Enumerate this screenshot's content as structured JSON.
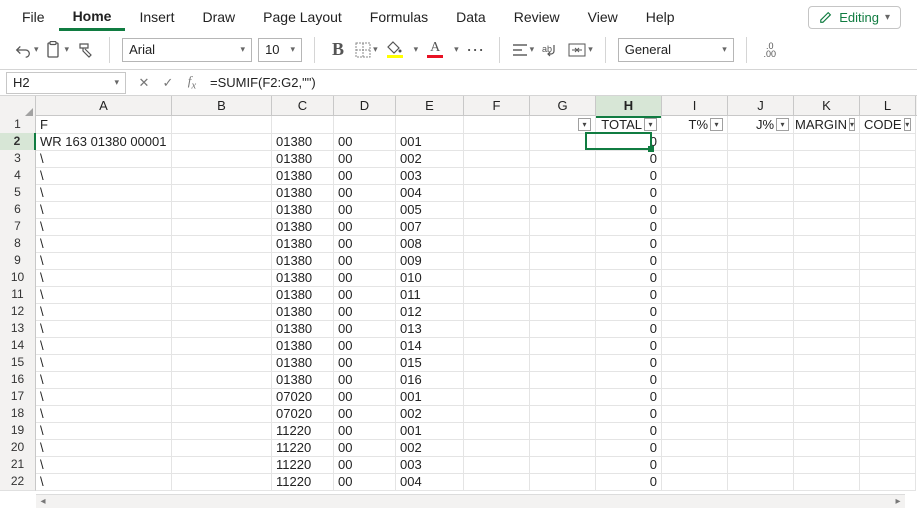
{
  "menu": {
    "tabs": [
      "File",
      "Home",
      "Insert",
      "Draw",
      "Page Layout",
      "Formulas",
      "Data",
      "Review",
      "View",
      "Help"
    ],
    "active": 1,
    "editing_label": "Editing"
  },
  "ribbon": {
    "font_name": "Arial",
    "font_size": "10",
    "number_format": "General"
  },
  "formula_bar": {
    "name_box": "H2",
    "formula": "=SUMIF(F2:G2,\"\")"
  },
  "columns": [
    "A",
    "B",
    "C",
    "D",
    "E",
    "F",
    "G",
    "H",
    "I",
    "J",
    "K",
    "L"
  ],
  "selected_column_index": 7,
  "selected_row": 2,
  "header_row": {
    "A": "F",
    "H": "TOTAL",
    "I": "T%",
    "J": "J%",
    "K": "MARGIN",
    "L": "CODE"
  },
  "rows": [
    {
      "num": 1
    },
    {
      "num": 2,
      "A": "WR 163 01380 00001",
      "C": "01380",
      "D": "00",
      "E": "001",
      "H": "0"
    },
    {
      "num": 3,
      "A": "\\",
      "C": "01380",
      "D": "00",
      "E": "002",
      "H": "0"
    },
    {
      "num": 4,
      "A": "\\",
      "C": "01380",
      "D": "00",
      "E": "003",
      "H": "0"
    },
    {
      "num": 5,
      "A": "\\",
      "C": "01380",
      "D": "00",
      "E": "004",
      "H": "0"
    },
    {
      "num": 6,
      "A": "\\",
      "C": "01380",
      "D": "00",
      "E": "005",
      "H": "0"
    },
    {
      "num": 7,
      "A": "\\",
      "C": "01380",
      "D": "00",
      "E": "007",
      "H": "0"
    },
    {
      "num": 8,
      "A": "\\",
      "C": "01380",
      "D": "00",
      "E": "008",
      "H": "0"
    },
    {
      "num": 9,
      "A": "\\",
      "C": "01380",
      "D": "00",
      "E": "009",
      "H": "0"
    },
    {
      "num": 10,
      "A": "\\",
      "C": "01380",
      "D": "00",
      "E": "010",
      "H": "0"
    },
    {
      "num": 11,
      "A": "\\",
      "C": "01380",
      "D": "00",
      "E": "011",
      "H": "0"
    },
    {
      "num": 12,
      "A": "\\",
      "C": "01380",
      "D": "00",
      "E": "012",
      "H": "0"
    },
    {
      "num": 13,
      "A": "\\",
      "C": "01380",
      "D": "00",
      "E": "013",
      "H": "0"
    },
    {
      "num": 14,
      "A": "\\",
      "C": "01380",
      "D": "00",
      "E": "014",
      "H": "0"
    },
    {
      "num": 15,
      "A": "\\",
      "C": "01380",
      "D": "00",
      "E": "015",
      "H": "0"
    },
    {
      "num": 16,
      "A": "\\",
      "C": "01380",
      "D": "00",
      "E": "016",
      "H": "0"
    },
    {
      "num": 17,
      "A": "\\",
      "C": "07020",
      "D": "00",
      "E": "001",
      "H": "0"
    },
    {
      "num": 18,
      "A": "\\",
      "C": "07020",
      "D": "00",
      "E": "002",
      "H": "0"
    },
    {
      "num": 19,
      "A": "\\",
      "C": "11220",
      "D": "00",
      "E": "001",
      "H": "0"
    },
    {
      "num": 20,
      "A": "\\",
      "C": "11220",
      "D": "00",
      "E": "002",
      "H": "0"
    },
    {
      "num": 21,
      "A": "\\",
      "C": "11220",
      "D": "00",
      "E": "003",
      "H": "0"
    },
    {
      "num": 22,
      "A": "\\",
      "C": "11220",
      "D": "00",
      "E": "004",
      "H": "0"
    }
  ],
  "chart_data": {
    "type": "table",
    "columns": [
      "A",
      "B",
      "C",
      "D",
      "E",
      "F",
      "G",
      "H",
      "I",
      "J",
      "K",
      "L"
    ],
    "header_labels": {
      "H": "TOTAL",
      "I": "T%",
      "J": "J%",
      "K": "MARGIN",
      "L": "CODE"
    },
    "records": [
      {
        "A": "WR 163 01380 00001",
        "C": "01380",
        "D": "00",
        "E": "001",
        "H": 0
      },
      {
        "C": "01380",
        "D": "00",
        "E": "002",
        "H": 0
      },
      {
        "C": "01380",
        "D": "00",
        "E": "003",
        "H": 0
      },
      {
        "C": "01380",
        "D": "00",
        "E": "004",
        "H": 0
      },
      {
        "C": "01380",
        "D": "00",
        "E": "005",
        "H": 0
      },
      {
        "C": "01380",
        "D": "00",
        "E": "007",
        "H": 0
      },
      {
        "C": "01380",
        "D": "00",
        "E": "008",
        "H": 0
      },
      {
        "C": "01380",
        "D": "00",
        "E": "009",
        "H": 0
      },
      {
        "C": "01380",
        "D": "00",
        "E": "010",
        "H": 0
      },
      {
        "C": "01380",
        "D": "00",
        "E": "011",
        "H": 0
      },
      {
        "C": "01380",
        "D": "00",
        "E": "012",
        "H": 0
      },
      {
        "C": "01380",
        "D": "00",
        "E": "013",
        "H": 0
      },
      {
        "C": "01380",
        "D": "00",
        "E": "014",
        "H": 0
      },
      {
        "C": "01380",
        "D": "00",
        "E": "015",
        "H": 0
      },
      {
        "C": "01380",
        "D": "00",
        "E": "016",
        "H": 0
      },
      {
        "C": "07020",
        "D": "00",
        "E": "001",
        "H": 0
      },
      {
        "C": "07020",
        "D": "00",
        "E": "002",
        "H": 0
      },
      {
        "C": "11220",
        "D": "00",
        "E": "001",
        "H": 0
      },
      {
        "C": "11220",
        "D": "00",
        "E": "002",
        "H": 0
      },
      {
        "C": "11220",
        "D": "00",
        "E": "003",
        "H": 0
      },
      {
        "C": "11220",
        "D": "00",
        "E": "004",
        "H": 0
      }
    ]
  }
}
